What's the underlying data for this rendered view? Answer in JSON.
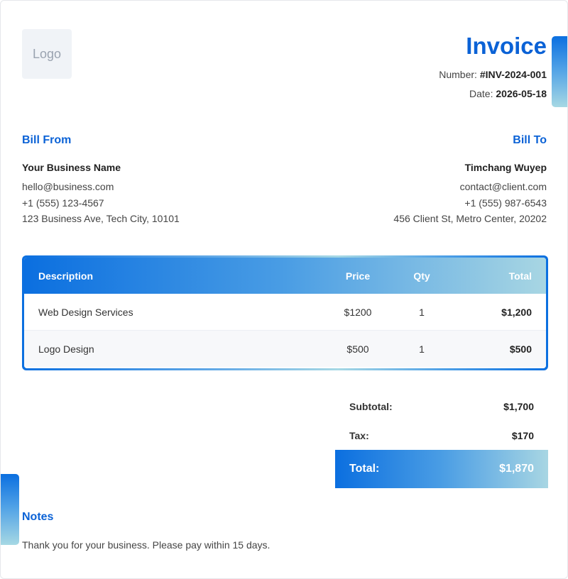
{
  "logo": {
    "text": "Logo"
  },
  "invoice": {
    "title": "Invoice",
    "number_label": "Number:",
    "number": "#INV-2024-001",
    "date_label": "Date:",
    "date": "2026-05-18"
  },
  "bill_from": {
    "heading": "Bill From",
    "name": "Your Business Name",
    "email": "hello@business.com",
    "phone": "+1 (555) 123-4567",
    "address": "123 Business Ave, Tech City, 10101"
  },
  "bill_to": {
    "heading": "Bill To",
    "name": "Timchang Wuyep",
    "email": "contact@client.com",
    "phone": "+1 (555) 987-6543",
    "address": "456 Client St, Metro Center, 20202"
  },
  "items_table": {
    "headers": [
      "Description",
      "Price",
      "Qty",
      "Total"
    ],
    "rows": [
      [
        "Web Design Services",
        "$1200",
        "1",
        "$1,200"
      ],
      [
        "Logo Design",
        "$500",
        "1",
        "$500"
      ]
    ]
  },
  "totals": {
    "subtotal_label": "Subtotal:",
    "subtotal": "$1,700",
    "tax_label": "Tax:",
    "tax": "$170",
    "total_label": "Total:",
    "total": "$1,870"
  },
  "notes": {
    "heading": "Notes",
    "text": "Thank you for your business. Please pay within 15 days."
  },
  "colors": {
    "accent": "#0b62d6",
    "gradient_start": "#0b6fe0",
    "gradient_end": "#a8d6e3"
  }
}
